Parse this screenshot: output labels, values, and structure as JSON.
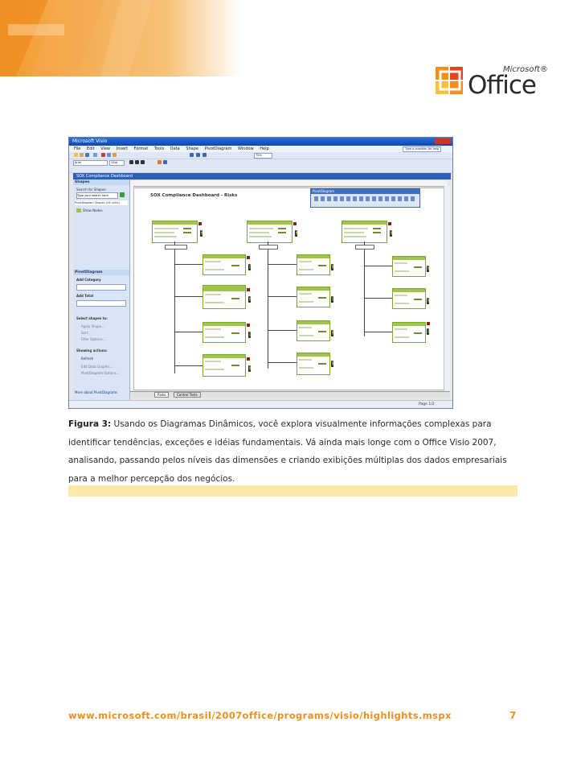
{
  "logo": {
    "word": "Office",
    "brand": "Microsoft®"
  },
  "screenshot": {
    "app_title": "Microsoft Visio",
    "menu": [
      "File",
      "Edit",
      "View",
      "Insert",
      "Format",
      "Tools",
      "Data",
      "Shape",
      "PivotDiagram",
      "Window",
      "Help"
    ],
    "help_box": "Type a question for help",
    "font_name": "Arial",
    "font_size": "12pt",
    "zoom": "75%",
    "document_title": "SOX Compliance Dashboard",
    "shapes_pane": {
      "title": "Shapes",
      "search_label": "Search for Shapes:",
      "search_placeholder": "Type your search here",
      "stencil": "PivotDiagram Shapes (US units)",
      "item": "Show Nodes"
    },
    "pivot_pane": {
      "title": "PivotDiagram",
      "add_category": "Add Category",
      "add_total": "Add Total",
      "select_shapes": "Select shapes to:",
      "actions": [
        "Apply Shape...",
        "Sort...",
        "Filter Options..."
      ],
      "showing_actions": "Showing actions:",
      "refresh": "Refresh",
      "edit_data_graphic": "Edit Data Graphic...",
      "options": "PivotDiagram Options...",
      "more": "More about PivotDiagrams"
    },
    "diagram_title": "SOX Compliance Dashboard - Risks",
    "pivot_window_title": "PivotDiagram",
    "tabs": [
      "Risks",
      "Control Tests"
    ],
    "status": "Page 1/2"
  },
  "caption": {
    "label": "Figura 3:",
    "text": " Usando os Diagramas Dinâmicos, você explora visualmente informações complexas para identificar tendências, exceções e idéias fundamentais. Vá ainda mais longe com o Office Visio 2007, analisando, passando pelos níveis das dimensões e criando exibições múltiplas dos dados empresariais para a melhor percepção dos negócios."
  },
  "footer": {
    "url": "www.microsoft.com/brasil/2007office/programs/visio/highlights.mspx",
    "page": "7"
  },
  "colors": {
    "accent": "#f28f1a",
    "band": "#fce9a9"
  }
}
